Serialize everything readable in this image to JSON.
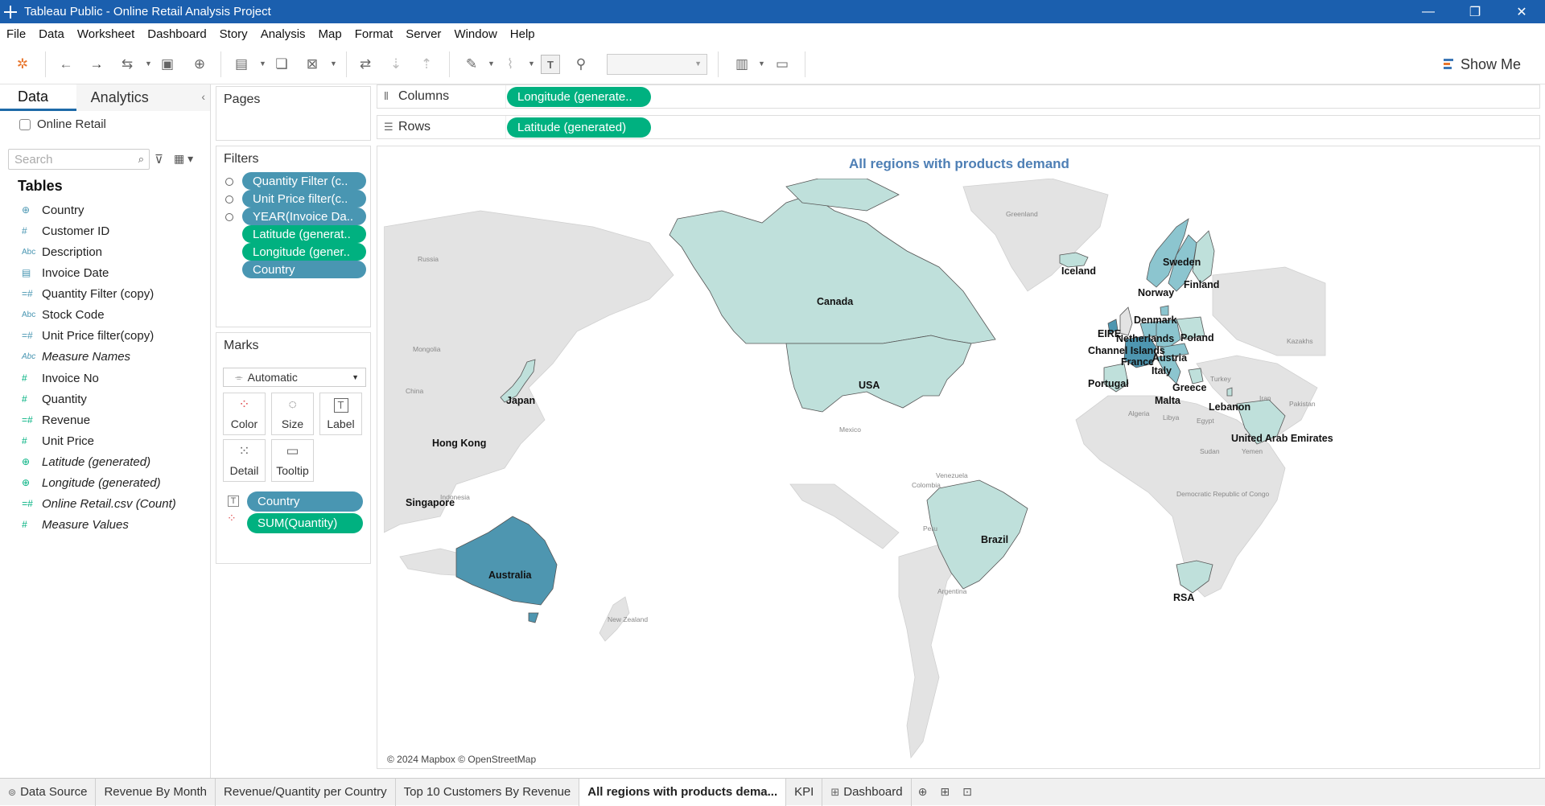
{
  "window": {
    "title": "Tableau Public - Online Retail  Analysis Project",
    "controls": {
      "minimize": "—",
      "restore": "❐",
      "close": "✕"
    }
  },
  "menu": [
    "File",
    "Data",
    "Worksheet",
    "Dashboard",
    "Story",
    "Analysis",
    "Map",
    "Format",
    "Server",
    "Window",
    "Help"
  ],
  "toolbar": {
    "show_me": "Show Me"
  },
  "left_pane": {
    "tabs": {
      "data": "Data",
      "analytics": "Analytics"
    },
    "datasource": "Online Retail",
    "search_placeholder": "Search",
    "tables_heading": "Tables",
    "fields": [
      {
        "name": "Country",
        "type": "geo",
        "role": "dim",
        "italic": false
      },
      {
        "name": "Customer ID",
        "type": "#",
        "role": "dim",
        "italic": false
      },
      {
        "name": "Description",
        "type": "Abc",
        "role": "dim",
        "italic": false
      },
      {
        "name": "Invoice Date",
        "type": "date",
        "role": "dim",
        "italic": false
      },
      {
        "name": "Quantity Filter (copy)",
        "type": "=#",
        "role": "dim",
        "italic": false
      },
      {
        "name": "Stock Code",
        "type": "Abc",
        "role": "dim",
        "italic": false
      },
      {
        "name": "Unit Price filter(copy)",
        "type": "=#",
        "role": "dim",
        "italic": false
      },
      {
        "name": "Measure Names",
        "type": "Abc",
        "role": "dim",
        "italic": true
      },
      {
        "name": "Invoice No",
        "type": "#",
        "role": "mea",
        "italic": false
      },
      {
        "name": "Quantity",
        "type": "#",
        "role": "mea",
        "italic": false
      },
      {
        "name": "Revenue",
        "type": "=#",
        "role": "mea",
        "italic": false
      },
      {
        "name": "Unit Price",
        "type": "#",
        "role": "mea",
        "italic": false
      },
      {
        "name": "Latitude (generated)",
        "type": "geo",
        "role": "mea",
        "italic": true
      },
      {
        "name": "Longitude (generated)",
        "type": "geo",
        "role": "mea",
        "italic": true
      },
      {
        "name": "Online Retail.csv (Count)",
        "type": "=#",
        "role": "mea",
        "italic": true
      },
      {
        "name": "Measure Values",
        "type": "#",
        "role": "mea",
        "italic": true
      }
    ]
  },
  "pages": {
    "heading": "Pages"
  },
  "filters": {
    "heading": "Filters",
    "items": [
      {
        "label": "Quantity Filter (c..",
        "color": "blue",
        "dot": true
      },
      {
        "label": "Unit Price filter(c..",
        "color": "blue",
        "dot": true
      },
      {
        "label": "YEAR(Invoice Da..",
        "color": "blue",
        "dot": true
      },
      {
        "label": "Latitude (generat..",
        "color": "green",
        "dot": false
      },
      {
        "label": "Longitude (gener..",
        "color": "green",
        "dot": false
      },
      {
        "label": "Country",
        "color": "blue",
        "dot": false
      }
    ]
  },
  "marks": {
    "heading": "Marks",
    "type": "Automatic",
    "buttons": [
      "Color",
      "Size",
      "Label",
      "Detail",
      "Tooltip"
    ],
    "pills": [
      {
        "label": "Country",
        "icon": "label-icon",
        "color": "blue"
      },
      {
        "label": "SUM(Quantity)",
        "icon": "color-icon",
        "color": "green"
      }
    ]
  },
  "shelves": {
    "columns": {
      "label": "Columns",
      "pill": "Longitude (generate.."
    },
    "rows": {
      "label": "Rows",
      "pill": "Latitude (generated)"
    }
  },
  "view": {
    "title": "All regions with products demand",
    "credits": "© 2024 Mapbox © OpenStreetMap",
    "country_labels": [
      "Canada",
      "USA",
      "Brazil",
      "Australia",
      "Japan",
      "Hong Kong",
      "Singapore",
      "Iceland",
      "Sweden",
      "Finland",
      "Norway",
      "Denmark",
      "EIRE",
      "Netherlands",
      "Poland",
      "Channel Islands",
      "Austria",
      "France",
      "Italy",
      "Portugal",
      "Greece",
      "Malta",
      "Lebanon",
      "United Arab Emirates",
      "RSA"
    ],
    "base_labels": [
      "Greenland",
      "Russia",
      "Mongolia",
      "China",
      "Mexico",
      "Venezuela",
      "Colombia",
      "Peru",
      "Argentina",
      "New Zealand",
      "Indonesia",
      "Algeria",
      "Libya",
      "Egypt",
      "Sudan",
      "Iran",
      "Turkey",
      "Kazakhs",
      "Yemen",
      "Pakistan",
      "Democratic Republic of Congo"
    ]
  },
  "colors": {
    "titlebar": "#1b5fae",
    "pill_blue": "#4996b2",
    "pill_green": "#00b180",
    "ocean": "#ffffff",
    "land": "#e3e3e3",
    "country_light": "#bfe0db",
    "country_mid": "#8cc5cf",
    "country_dark": "#4e96b0",
    "view_title": "#4e7fb5"
  },
  "sheet_tabs": [
    {
      "label": "Data Source",
      "icon": "datasource-icon",
      "active": false
    },
    {
      "label": "Revenue By Month",
      "active": false
    },
    {
      "label": "Revenue/Quantity per Country",
      "active": false
    },
    {
      "label": "Top 10 Customers By Revenue",
      "active": false
    },
    {
      "label": "All regions with products dema...",
      "active": true
    },
    {
      "label": "KPI",
      "active": false
    },
    {
      "label": "Dashboard",
      "icon": "dashboard-icon",
      "active": false
    }
  ]
}
